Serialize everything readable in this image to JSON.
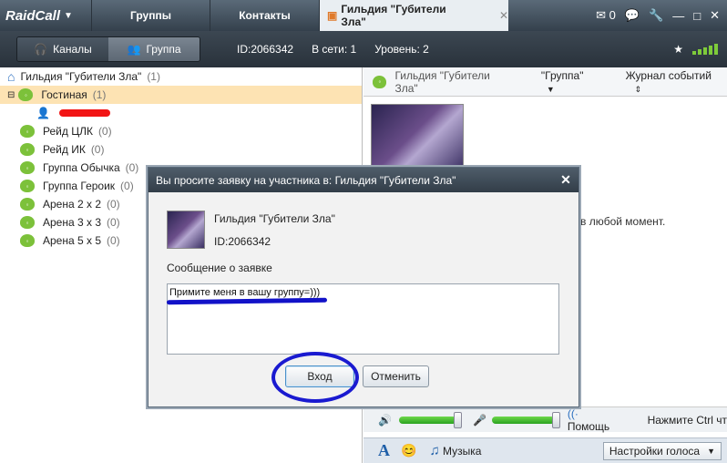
{
  "top": {
    "logo": "RaidCall",
    "tabs": [
      "Группы",
      "Контакты"
    ],
    "active_tab": "Гильдия \"Губители Зла\"",
    "mail_count": "0"
  },
  "sub": {
    "seg_channels": "Каналы",
    "seg_group": "Группа",
    "id": "ID:2066342",
    "online": "В сети: 1",
    "level": "Уровень: 2"
  },
  "tree": {
    "root": {
      "label": "Гильдия \"Губители Зла\"",
      "count": "(1)"
    },
    "lobby": {
      "label": "Гостиная",
      "count": "(1)"
    },
    "channels": [
      {
        "label": "Рейд ЦЛК",
        "count": "(0)"
      },
      {
        "label": "Рейд ИК",
        "count": "(0)"
      },
      {
        "label": "Группа Обычка",
        "count": "(0)"
      },
      {
        "label": "Группа Героик",
        "count": "(0)"
      },
      {
        "label": "Арена 2 х 2",
        "count": "(0)"
      },
      {
        "label": "Арена 3 х 3",
        "count": "(0)"
      },
      {
        "label": "Арена 5 х 5",
        "count": "(0)"
      }
    ]
  },
  "right": {
    "guild": "Гильдия \"Губители Зла\"",
    "group_menu": "\"Группа\"",
    "journal": "Журнал событий",
    "notice": "о в любой момент.",
    "help": "Помощь",
    "hint": "Нажмите Ctrl чт",
    "music": "Музыка",
    "voice_settings": "Настройки голоса"
  },
  "dialog": {
    "title": "Вы просите заявку на участника в: Гильдия \"Губители Зла\"",
    "guild": "Гильдия \"Губители Зла\"",
    "id": "ID:2066342",
    "message_label": "Сообщение о заявке",
    "message": "Примите меня в вашу группу=)))",
    "ok": "Вход",
    "cancel": "Отменить"
  },
  "colors": {
    "channel_green": "#7cc13a",
    "highlight": "#fde3b3",
    "annotation_blue": "#1212c8",
    "annotation_red": "#f21515"
  }
}
